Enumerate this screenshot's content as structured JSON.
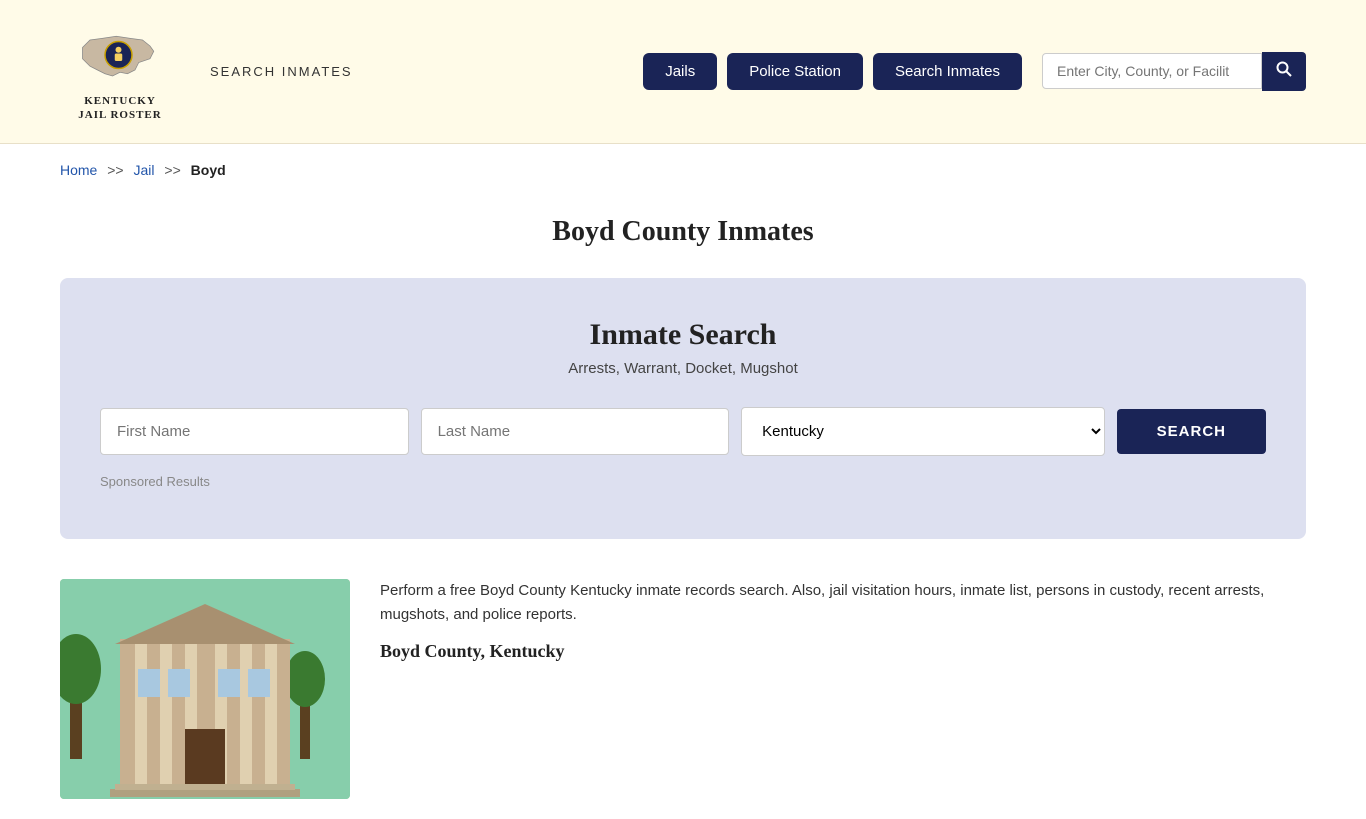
{
  "header": {
    "logo_line1": "KENTUCKY",
    "logo_line2": "JAIL ROSTER",
    "site_title": "SEARCH INMATES",
    "nav_buttons": [
      {
        "label": "Jails",
        "id": "jails"
      },
      {
        "label": "Police Station",
        "id": "police-station"
      },
      {
        "label": "Search Inmates",
        "id": "search-inmates"
      }
    ],
    "search_placeholder": "Enter City, County, or Facilit"
  },
  "breadcrumb": {
    "home": "Home",
    "jail": "Jail",
    "current": "Boyd",
    "sep": ">>"
  },
  "page": {
    "title": "Boyd County Inmates",
    "search_section_title": "Inmate Search",
    "search_section_subtitle": "Arrests, Warrant, Docket, Mugshot",
    "first_name_placeholder": "First Name",
    "last_name_placeholder": "Last Name",
    "state_default": "Kentucky",
    "search_button": "SEARCH",
    "sponsored_label": "Sponsored Results"
  },
  "description": {
    "text": "Perform a free Boyd County Kentucky inmate records search. Also, jail visitation hours, inmate list, persons in custody, recent arrests, mugshots, and police reports.",
    "subheading": "Boyd County, Kentucky"
  },
  "colors": {
    "navy": "#1a2456",
    "bg_header": "#fffbe8",
    "bg_search": "#dde0f0",
    "link": "#2255aa"
  }
}
